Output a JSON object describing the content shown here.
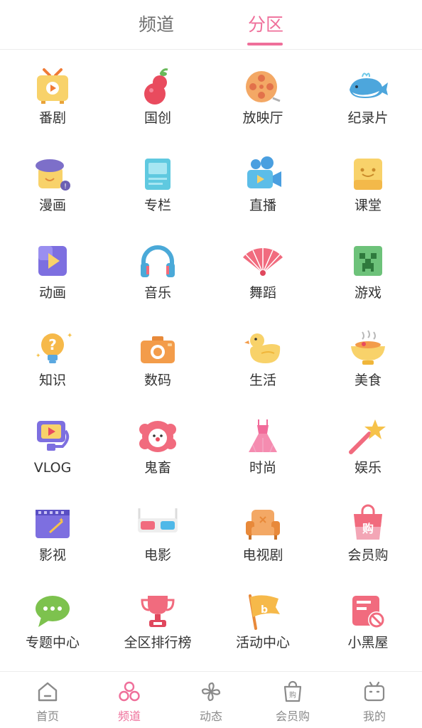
{
  "top_tabs": [
    {
      "label": "频道",
      "active": false
    },
    {
      "label": "分区",
      "active": true
    }
  ],
  "accent_color": "#ef6f9a",
  "categories": [
    {
      "label": "番剧",
      "icon": "tv-icon"
    },
    {
      "label": "国创",
      "icon": "gourd-icon"
    },
    {
      "label": "放映厅",
      "icon": "film-reel-icon"
    },
    {
      "label": "纪录片",
      "icon": "whale-icon"
    },
    {
      "label": "漫画",
      "icon": "beret-character-icon"
    },
    {
      "label": "专栏",
      "icon": "article-icon"
    },
    {
      "label": "直播",
      "icon": "video-camera-icon"
    },
    {
      "label": "课堂",
      "icon": "smiley-block-icon"
    },
    {
      "label": "动画",
      "icon": "play-box-icon"
    },
    {
      "label": "音乐",
      "icon": "headphones-icon"
    },
    {
      "label": "舞蹈",
      "icon": "folding-fan-icon"
    },
    {
      "label": "游戏",
      "icon": "creeper-icon"
    },
    {
      "label": "知识",
      "icon": "question-bulb-icon"
    },
    {
      "label": "数码",
      "icon": "camera-icon"
    },
    {
      "label": "生活",
      "icon": "duck-icon"
    },
    {
      "label": "美食",
      "icon": "food-bowl-icon"
    },
    {
      "label": "VLOG",
      "icon": "video-selfie-icon"
    },
    {
      "label": "鬼畜",
      "icon": "clown-icon"
    },
    {
      "label": "时尚",
      "icon": "dress-icon"
    },
    {
      "label": "娱乐",
      "icon": "star-wand-icon"
    },
    {
      "label": "影视",
      "icon": "clapper-board-icon"
    },
    {
      "label": "电影",
      "icon": "3d-glasses-icon"
    },
    {
      "label": "电视剧",
      "icon": "armchair-icon"
    },
    {
      "label": "会员购",
      "icon": "shopping-bag-icon"
    },
    {
      "label": "专题中心",
      "icon": "chat-bubble-icon"
    },
    {
      "label": "全区排行榜",
      "icon": "trophy-icon"
    },
    {
      "label": "活动中心",
      "icon": "flag-icon"
    },
    {
      "label": "小黑屋",
      "icon": "banned-card-icon"
    }
  ],
  "bottom_nav": [
    {
      "label": "首页",
      "icon": "home-icon",
      "active": false
    },
    {
      "label": "频道",
      "icon": "channels-icon",
      "active": true
    },
    {
      "label": "动态",
      "icon": "pinwheel-icon",
      "active": false
    },
    {
      "label": "会员购",
      "icon": "shopping-bag-icon",
      "active": false
    },
    {
      "label": "我的",
      "icon": "bilibili-tv-icon",
      "active": false
    }
  ]
}
